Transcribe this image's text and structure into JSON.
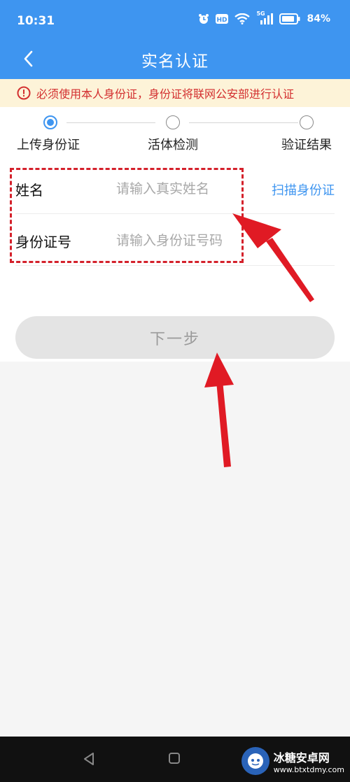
{
  "status_bar": {
    "time": "10:31",
    "network": "5G",
    "battery": "84%"
  },
  "header": {
    "title": "实名认证"
  },
  "notice": {
    "text": "必须使用本人身份证，身份证将联网公安部进行认证"
  },
  "steps": [
    {
      "label": "上传身份证",
      "state": "active"
    },
    {
      "label": "活体检测",
      "state": "pending"
    },
    {
      "label": "验证结果",
      "state": "pending"
    }
  ],
  "form": {
    "name_label": "姓名",
    "name_placeholder": "请输入真实姓名",
    "id_label": "身份证号",
    "id_placeholder": "请输入身份证号码",
    "scan_link": "扫描身份证"
  },
  "next_button": {
    "label": "下一步"
  },
  "watermark": {
    "name": "冰糖安卓网",
    "url": "www.btxtdmy.com"
  },
  "colors": {
    "primary": "#3e95f0",
    "warning": "#d32f2f",
    "annotation": "#d4212b"
  }
}
